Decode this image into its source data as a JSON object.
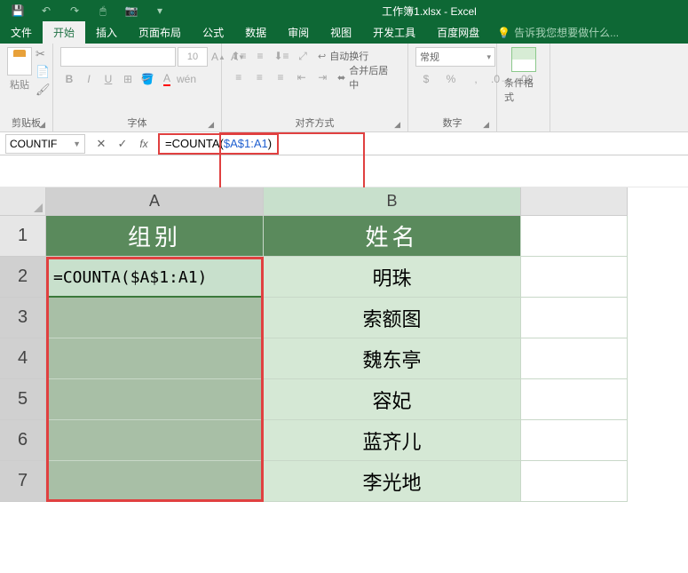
{
  "title": "工作簿1.xlsx - Excel",
  "tabs": {
    "file": "文件",
    "home": "开始",
    "insert": "插入",
    "layout": "页面布局",
    "formulas": "公式",
    "data": "数据",
    "review": "审阅",
    "view": "视图",
    "dev": "开发工具",
    "baidu": "百度网盘",
    "tellme": "告诉我您想要做什么..."
  },
  "ribbon": {
    "clipboard": {
      "paste": "粘贴",
      "label": "剪贴板"
    },
    "font": {
      "size": "10",
      "label": "字体"
    },
    "align": {
      "wrap": "自动换行",
      "merge": "合并后居中",
      "label": "对齐方式"
    },
    "number": {
      "format": "常规",
      "label": "数字"
    },
    "styles": {
      "cond": "条件格式",
      "label": ""
    }
  },
  "namebox": "COUNTIF",
  "formula": {
    "prefix": "=COUNTA(",
    "ref": "$A$1:A1",
    "suffix": ")"
  },
  "columns": {
    "A": "A",
    "B": "B"
  },
  "rows": [
    "1",
    "2",
    "3",
    "4",
    "5",
    "6",
    "7"
  ],
  "headers": {
    "group": "组别",
    "name": "姓名"
  },
  "cellA2": "=COUNTA($A$1:A1)",
  "names": [
    "明珠",
    "索额图",
    "魏东亭",
    "容妃",
    "蓝齐儿",
    "李光地"
  ],
  "chart_data": null
}
